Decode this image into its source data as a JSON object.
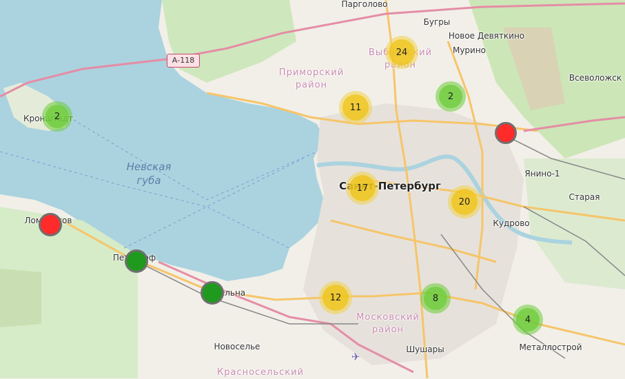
{
  "water_label": "Невская\nгуба",
  "road_shield": "А-118",
  "districts": [
    {
      "id": "primorsky",
      "text": "Приморский\nрайон"
    },
    {
      "id": "vyborgsky",
      "text": "Выборгский\nрайон"
    },
    {
      "id": "moskovsky",
      "text": "Московский\nрайон"
    },
    {
      "id": "krasnoselsky",
      "text": "Красносельский"
    }
  ],
  "places": [
    {
      "id": "pargolovo",
      "text": "Парголово"
    },
    {
      "id": "bugry",
      "text": "Бугры"
    },
    {
      "id": "novoe-devyatkino",
      "text": "Новое Девяткино"
    },
    {
      "id": "murino",
      "text": "Мурино"
    },
    {
      "id": "vsevolozhsk",
      "text": "Всеволожск"
    },
    {
      "id": "yanino",
      "text": "Янино-1"
    },
    {
      "id": "staraya",
      "text": "Старая"
    },
    {
      "id": "kudrovo",
      "text": "Кудрово"
    },
    {
      "id": "metallostroy",
      "text": "Металлострой"
    },
    {
      "id": "shushary",
      "text": "Шушары"
    },
    {
      "id": "novoselye",
      "text": "Новоселье"
    },
    {
      "id": "kronshtadt",
      "text": "Кронштадт"
    },
    {
      "id": "lomonosov",
      "text": "Ломоносов"
    },
    {
      "id": "peterhof",
      "text": "Петергоф"
    },
    {
      "id": "strelna",
      "text": "Стрельна"
    }
  ],
  "city_label": "Санкт-Петербург",
  "clusters": [
    {
      "id": "vyborgsky",
      "count": "24",
      "color": "yellow"
    },
    {
      "id": "primorsky",
      "count": "11",
      "color": "yellow"
    },
    {
      "id": "murino",
      "count": "2",
      "color": "green"
    },
    {
      "id": "kronshtadt",
      "count": "2",
      "color": "green"
    },
    {
      "id": "center",
      "count": "17",
      "color": "yellow"
    },
    {
      "id": "east",
      "count": "20",
      "color": "yellow"
    },
    {
      "id": "moskovsky",
      "count": "12",
      "color": "yellow"
    },
    {
      "id": "south",
      "count": "8",
      "color": "green"
    },
    {
      "id": "metallostroy",
      "count": "4",
      "color": "green"
    }
  ],
  "markers": [
    {
      "id": "vsevolozhsk-area",
      "status": "red"
    },
    {
      "id": "lomonosov",
      "status": "red"
    },
    {
      "id": "peterhof",
      "status": "green"
    },
    {
      "id": "strelna",
      "status": "green"
    }
  ],
  "colors": {
    "water": "#aad3df",
    "land": "#f2efe9",
    "park": "#c8e6b4",
    "road": "#f7d08a",
    "rail": "#888888"
  }
}
